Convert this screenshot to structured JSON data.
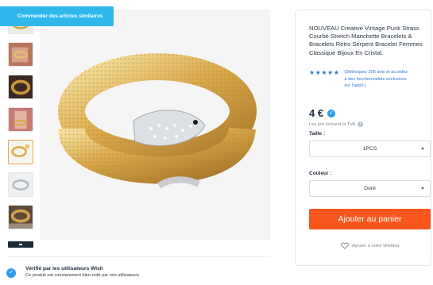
{
  "banner": {
    "label": "Commander des articles similaires"
  },
  "product": {
    "title": "NOUVEAU Creative Vintage Punk Strass Courbé Stretch Manchette Bracelets & Bracelets Rétro Serpent Bracelet Femmes Classique Bijoux En Cristal.",
    "stars": "★★★★★",
    "rating_note": "(Débloquez 206 avis et accédez à des fonctionnalités exclusives sur l'appli.)",
    "price": "4 €",
    "tax_note": "Les prix incluent la TVA",
    "size": {
      "label": "Taille :",
      "value": "1PCS"
    },
    "color": {
      "label": "Couleur :",
      "value": "Doré"
    },
    "add_to_cart": "Ajouter au panier",
    "wishlist": "Ajouter à votre Wishlist"
  },
  "verified": {
    "title": "Vérifié par les utilisateurs Wish",
    "description": "Ce produit est constamment bien noté par nos utilisateurs"
  },
  "colors": {
    "accent_blue": "#2fb7ec",
    "cart_orange": "#f7571d",
    "link_blue": "#2a7bd0"
  },
  "icons": [
    "verified-check-icon",
    "info-icon",
    "chevron-down-icon",
    "heart-icon"
  ]
}
